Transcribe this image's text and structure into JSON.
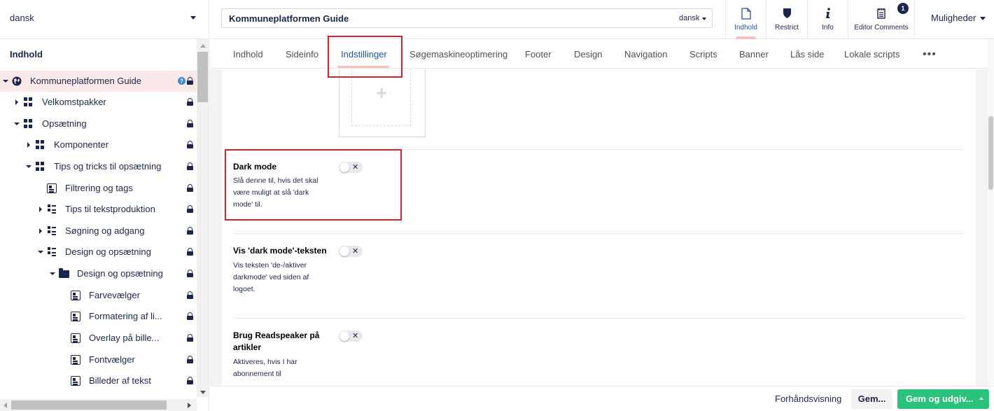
{
  "language_selector": {
    "value": "dansk"
  },
  "tree": {
    "heading": "Indhold",
    "nodes": [
      {
        "label": "Kommuneplatformen Guide",
        "icon": "globe-icon",
        "expanded": true
      },
      {
        "label": "Velkomstpakker",
        "icon": "grid-icon",
        "expanded": false
      },
      {
        "label": "Opsætning",
        "icon": "grid-icon",
        "expanded": true
      },
      {
        "label": "Komponenter",
        "icon": "grid-icon",
        "expanded": false
      },
      {
        "label": "Tips og tricks til opsætning",
        "icon": "grid-icon",
        "expanded": true
      },
      {
        "label": "Filtrering og tags",
        "icon": "document-icon"
      },
      {
        "label": "Tips til tekstproduktion",
        "icon": "list-icon",
        "expanded": false
      },
      {
        "label": "Søgning og adgang",
        "icon": "list-icon",
        "expanded": false
      },
      {
        "label": "Design og opsætning",
        "icon": "list-icon",
        "expanded": true
      },
      {
        "label": "Design og opsætning",
        "icon": "folder-icon",
        "expanded": true
      },
      {
        "label": "Farvevælger",
        "icon": "document-icon"
      },
      {
        "label": "Formatering af li...",
        "icon": "document-icon"
      },
      {
        "label": "Overlay på bille...",
        "icon": "document-icon"
      },
      {
        "label": "Fontvælger",
        "icon": "document-icon"
      },
      {
        "label": "Billeder af tekst",
        "icon": "document-icon"
      }
    ]
  },
  "header": {
    "node_name": "Kommuneplatformen Guide",
    "culture": "dansk",
    "apps": [
      {
        "label": "Indhold",
        "icon": "document-icon",
        "selected": true
      },
      {
        "label": "Restrict",
        "icon": "shield-icon"
      },
      {
        "label": "Info",
        "icon": "info-icon"
      },
      {
        "label": "Editor Comments",
        "icon": "notepad-icon",
        "badge": "1"
      }
    ],
    "options": "Muligheder"
  },
  "tabs": [
    {
      "label": "Indhold"
    },
    {
      "label": "Sideinfo"
    },
    {
      "label": "Indstillinger",
      "selected": true
    },
    {
      "label": "Søgemaskineoptimering"
    },
    {
      "label": "Footer"
    },
    {
      "label": "Design"
    },
    {
      "label": "Navigation"
    },
    {
      "label": "Scripts"
    },
    {
      "label": "Banner"
    },
    {
      "label": "Lås side"
    },
    {
      "label": "Lokale scripts"
    }
  ],
  "properties": [
    {
      "label": "Dark mode",
      "description": "Slå denne til, hvis det skal være muligt at slå 'dark mode' til.",
      "toggle_symbol": "✕",
      "on": false
    },
    {
      "label": "Vis 'dark mode'-teksten",
      "description": "Vis teksten 'de-/aktiver darkmode' ved siden af logoet.",
      "toggle_symbol": "✕",
      "on": false
    },
    {
      "label": "Brug Readspeaker på artikler",
      "description": "Aktiveres, hvis I har abonnement til",
      "toggle_symbol": "✕",
      "on": false
    }
  ],
  "footer": {
    "preview": "Forhåndsvisning",
    "save": "Gem...",
    "save_publish": "Gem og udgiv..."
  },
  "colors": {
    "accent": "#2152a3",
    "tab_indicator": "#f5c1bc",
    "active_node_bg": "#fbe9e9",
    "publish": "#2bc37c",
    "highlight": "#d9222a"
  }
}
